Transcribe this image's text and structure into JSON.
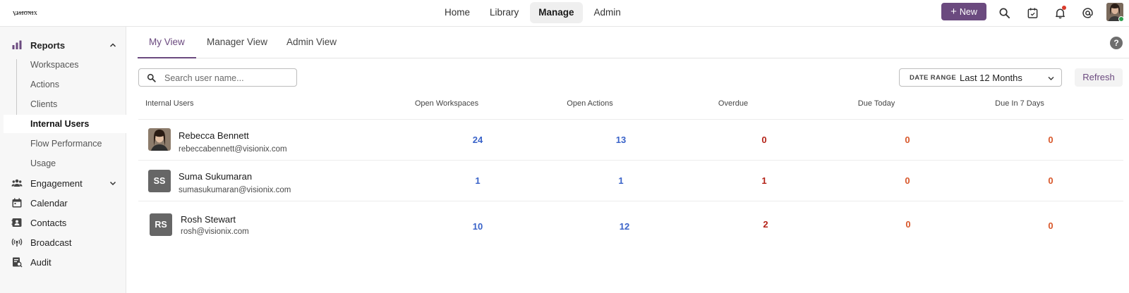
{
  "colors": {
    "brand": "#6b4a7f",
    "link_blue": "#3a63c9",
    "overdue_red": "#b42318",
    "due_orange": "#d8572a"
  },
  "topbar": {
    "logo_text": "VISIONIX",
    "nav": [
      "Home",
      "Library",
      "Manage",
      "Admin"
    ],
    "active_nav": "Manage",
    "new_button": "New",
    "icons": [
      "search-icon",
      "calendar-check-icon",
      "bell-icon",
      "at-mention-icon",
      "profile-avatar"
    ]
  },
  "sidebar": {
    "reports": {
      "label": "Reports",
      "icon": "bar-chart-icon",
      "expanded": true,
      "children": [
        "Workspaces",
        "Actions",
        "Clients",
        "Internal Users",
        "Flow Performance",
        "Usage"
      ],
      "active_child": "Internal Users"
    },
    "items": [
      {
        "label": "Engagement",
        "icon": "people-icon",
        "has_chevron": true
      },
      {
        "label": "Calendar",
        "icon": "calendar-icon"
      },
      {
        "label": "Contacts",
        "icon": "contacts-icon"
      },
      {
        "label": "Broadcast",
        "icon": "broadcast-icon"
      },
      {
        "label": "Audit",
        "icon": "audit-icon"
      }
    ]
  },
  "tabs": [
    "My View",
    "Manager View",
    "Admin View"
  ],
  "active_tab": "My View",
  "toolbar": {
    "search_placeholder": "Search user name...",
    "date_range_label": "DATE RANGE",
    "date_range_value": "Last 12 Months",
    "refresh_label": "Refresh"
  },
  "table": {
    "columns": [
      "Internal Users",
      "Open Workspaces",
      "Open Actions",
      "Overdue",
      "Due Today",
      "Due In 7 Days"
    ],
    "rows": [
      {
        "name": "Rebecca Bennett",
        "email": "rebeccabennett@visionix.com",
        "avatar": "photo",
        "open_workspaces": "24",
        "open_actions": "13",
        "overdue": "0",
        "due_today": "0",
        "due_7_days": "0"
      },
      {
        "name": "Suma Sukumaran",
        "email": "sumasukumaran@visionix.com",
        "avatar": "SS",
        "open_workspaces": "1",
        "open_actions": "1",
        "overdue": "1",
        "due_today": "0",
        "due_7_days": "0"
      },
      {
        "name": "Rosh Stewart",
        "email": "rosh@visionix.com",
        "avatar": "RS",
        "open_workspaces": "10",
        "open_actions": "12",
        "overdue": "2",
        "due_today": "0",
        "due_7_days": "0"
      }
    ]
  }
}
